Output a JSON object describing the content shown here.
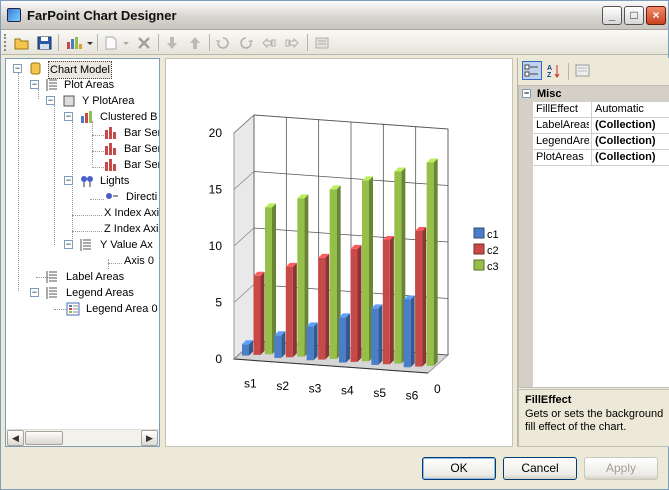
{
  "window": {
    "title": "FarPoint Chart Designer"
  },
  "tree": {
    "items": [
      {
        "label": "Chart Model"
      },
      {
        "label": "Plot Areas"
      },
      {
        "label": "Y PlotArea"
      },
      {
        "label": "Clustered B"
      },
      {
        "label": "Bar Ser"
      },
      {
        "label": "Bar Ser"
      },
      {
        "label": "Bar Ser"
      },
      {
        "label": "Lights"
      },
      {
        "label": "Directi"
      },
      {
        "label": "X Index Axi"
      },
      {
        "label": "Z Index Axi"
      },
      {
        "label": "Y Value Ax"
      },
      {
        "label": "Axis 0"
      },
      {
        "label": "Label Areas"
      },
      {
        "label": "Legend Areas"
      },
      {
        "label": "Legend Area 0"
      }
    ]
  },
  "chart_data": {
    "type": "bar",
    "categories": [
      "s1",
      "s2",
      "s3",
      "s4",
      "s5",
      "s6"
    ],
    "series": [
      {
        "name": "c1",
        "values": [
          1,
          2,
          3,
          4,
          5,
          6
        ]
      },
      {
        "name": "c2",
        "values": [
          7,
          8,
          9,
          10,
          11,
          12
        ]
      },
      {
        "name": "c3",
        "values": [
          13,
          14,
          15,
          16,
          17,
          18
        ]
      }
    ],
    "ylim": [
      0,
      20
    ],
    "yticks": [
      "0",
      "5",
      "10",
      "15",
      "20"
    ],
    "depth_label": "0",
    "colors": [
      "#4a7fc8",
      "#c84a48",
      "#96bf4a"
    ],
    "legend": "right",
    "grid": true
  },
  "properties": {
    "category": "Misc",
    "rows": [
      {
        "name": "FillEffect",
        "value": "Automatic"
      },
      {
        "name": "LabelAreas",
        "value": "(Collection)"
      },
      {
        "name": "LegendAre",
        "value": "(Collection)"
      },
      {
        "name": "PlotAreas",
        "value": "(Collection)"
      }
    ],
    "description_title": "FillEffect",
    "description_text": "Gets or sets the background fill effect of the chart."
  },
  "buttons": {
    "ok": "OK",
    "cancel": "Cancel",
    "apply": "Apply"
  },
  "icons": [
    "open-icon",
    "save-icon",
    "chart-type-icon",
    "new-icon",
    "delete-icon",
    "move-down-icon",
    "move-up-icon",
    "rotate-left-icon",
    "rotate-right-icon",
    "turn-left-icon",
    "turn-right-icon",
    "layout-icon",
    "categorized-icon",
    "alphabetical-icon",
    "property-pages-icon"
  ]
}
